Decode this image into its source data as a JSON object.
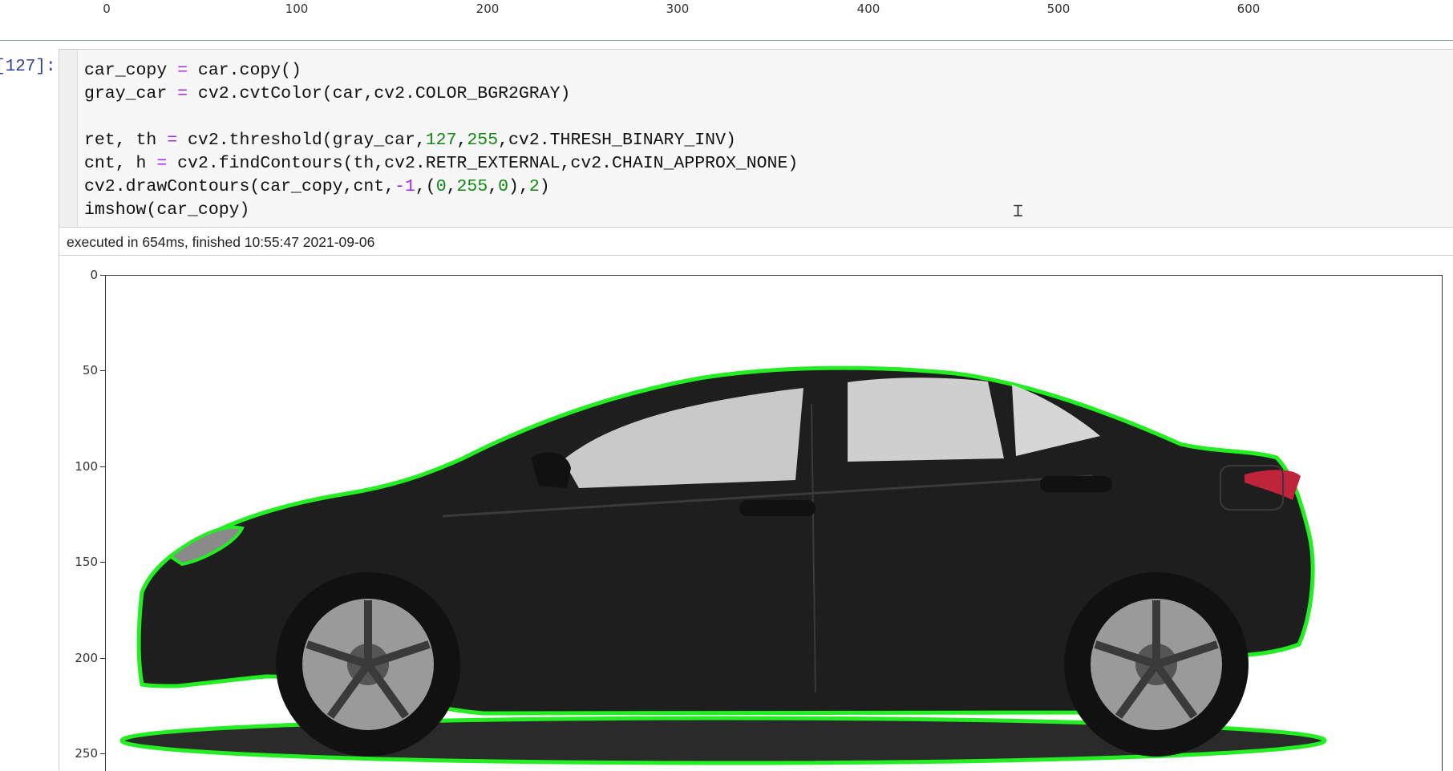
{
  "top_axis": {
    "ticks": [
      "0",
      "100",
      "200",
      "300",
      "400",
      "500",
      "600"
    ]
  },
  "input_prompt": "[127]:",
  "code_lines": [
    [
      {
        "t": "car_copy ",
        "c": ""
      },
      {
        "t": "=",
        "c": "op"
      },
      {
        "t": " car.copy()",
        "c": ""
      }
    ],
    [
      {
        "t": "gray_car ",
        "c": ""
      },
      {
        "t": "=",
        "c": "op"
      },
      {
        "t": " cv2.cvtColor(car,cv2.COLOR_BGR2GRAY)",
        "c": ""
      }
    ],
    [],
    [
      {
        "t": "ret, th ",
        "c": ""
      },
      {
        "t": "=",
        "c": "op"
      },
      {
        "t": " cv2.threshold(gray_car,",
        "c": ""
      },
      {
        "t": "127",
        "c": "num"
      },
      {
        "t": ",",
        "c": ""
      },
      {
        "t": "255",
        "c": "num"
      },
      {
        "t": ",cv2.THRESH_BINARY_INV)",
        "c": ""
      }
    ],
    [
      {
        "t": "cnt, h ",
        "c": ""
      },
      {
        "t": "=",
        "c": "op"
      },
      {
        "t": " cv2.findContours(th,cv2.RETR_EXTERNAL,cv2.CHAIN_APPROX_NONE)",
        "c": ""
      }
    ],
    [
      {
        "t": "cv2.drawContours(car_copy,cnt,",
        "c": ""
      },
      {
        "t": "-1",
        "c": "op"
      },
      {
        "t": ",(",
        "c": ""
      },
      {
        "t": "0",
        "c": "num"
      },
      {
        "t": ",",
        "c": ""
      },
      {
        "t": "255",
        "c": "num"
      },
      {
        "t": ",",
        "c": ""
      },
      {
        "t": "0",
        "c": "num"
      },
      {
        "t": "),",
        "c": ""
      },
      {
        "t": "2",
        "c": "num"
      },
      {
        "t": ")",
        "c": ""
      }
    ],
    [
      {
        "t": "imshow(car_copy)",
        "c": ""
      }
    ]
  ],
  "execution_info": "executed in 654ms, finished 10:55:47 2021-09-06",
  "plot": {
    "y_ticks": [
      "0",
      "50",
      "100",
      "150",
      "200",
      "250"
    ],
    "contour_color": "#22ee22",
    "car_color": "#1e1e1e"
  },
  "colors": {
    "prompt": "#303f9f",
    "operator": "#a626ff",
    "number": "#118811"
  }
}
